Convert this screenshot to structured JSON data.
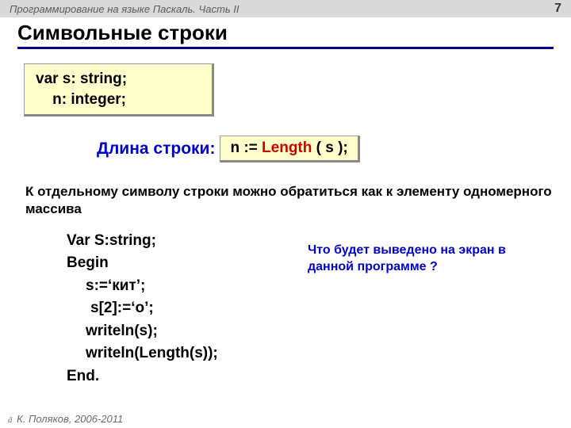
{
  "header": {
    "left": "Программирование на языке Паскаль. Часть II",
    "page": "7"
  },
  "title": "Символьные строки",
  "varBox": {
    "line1": "var s: string;",
    "line2_indent": "    n: integer;"
  },
  "lengthRow": {
    "label": "Длина строки:",
    "prefix": "n := ",
    "keyword": "Length",
    "suffix": " ( s );"
  },
  "paragraph": "К отдельному символу строки можно обратиться как к элементу одномерного массива",
  "code": {
    "l1": "Var S:string;",
    "l2": "Begin",
    "l3": "s:=‘кит’;",
    "l4": "s[2]:=‘о’;",
    "l5": "writeln(s);",
    "l6": "writeln(Length(s));",
    "l7": "End."
  },
  "question": "Что будет выведено на экран в данной программе ?",
  "footer": "К. Поляков, 2006-2011"
}
